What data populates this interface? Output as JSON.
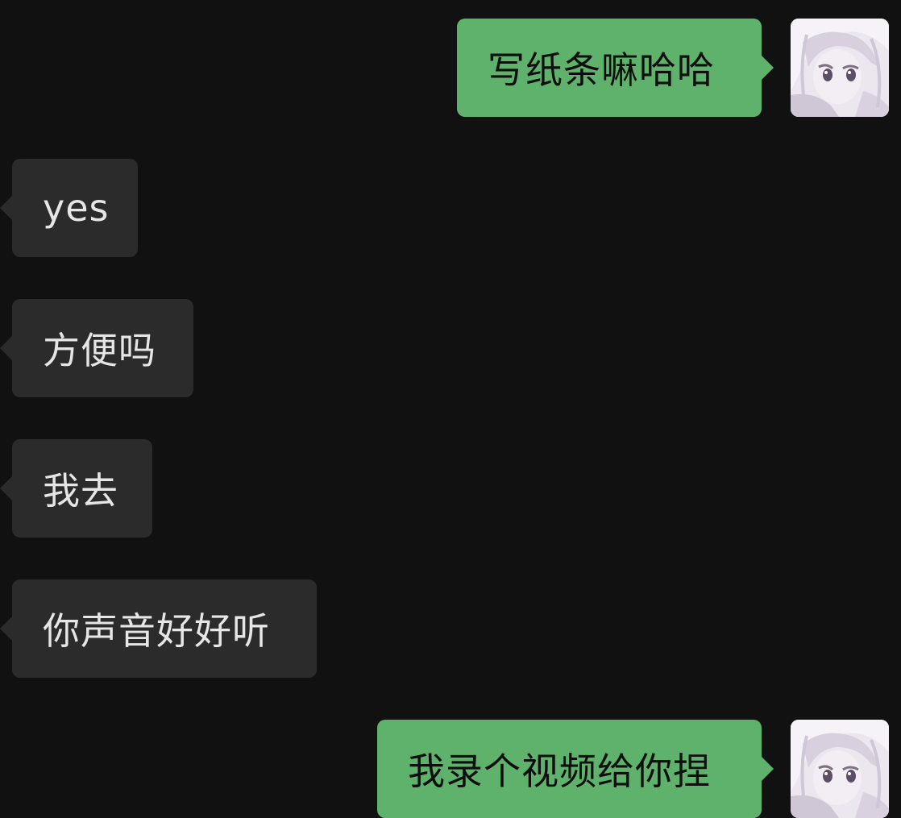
{
  "messages": [
    {
      "side": "sent",
      "text": "写纸条嘛哈哈"
    },
    {
      "side": "received",
      "text": "yes"
    },
    {
      "side": "received",
      "text": "方便吗"
    },
    {
      "side": "received",
      "text": "我去"
    },
    {
      "side": "received",
      "text": "你声音好好听"
    },
    {
      "side": "sent",
      "text": "我录个视频给你捏"
    }
  ],
  "avatar": {
    "icon": "anime-girl-avatar-icon"
  },
  "colors": {
    "background": "#111111",
    "sent_bubble": "#5fb26b",
    "received_bubble": "#2b2b2b",
    "sent_text": "#0e0e0e",
    "received_text": "#e6e6e6"
  }
}
